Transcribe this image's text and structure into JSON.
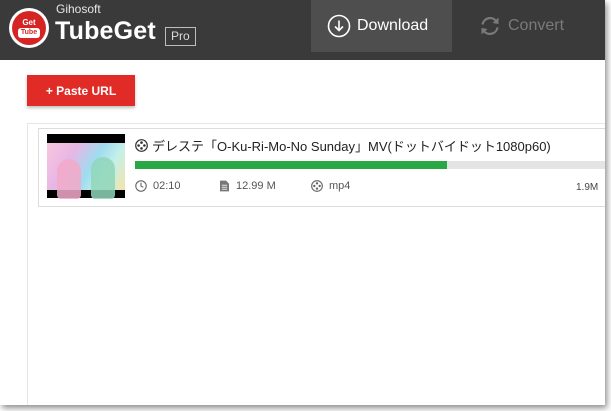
{
  "app": {
    "brand_small": "Gihosoft",
    "brand_name": "TubeGet",
    "edition_badge": "Pro",
    "logo_text_top": "Get",
    "logo_text_bottom": "Tube"
  },
  "tabs": [
    {
      "label": "Download",
      "icon": "download-circle-icon",
      "active": true
    },
    {
      "label": "Convert",
      "icon": "convert-refresh-icon",
      "active": false
    }
  ],
  "toolbar": {
    "paste_url_label": "+ Paste URL"
  },
  "downloads": [
    {
      "title": "デレステ「O-Ku-Ri-Mo-No Sunday」MV(ドットバイドット1080p60)",
      "duration": "02:10",
      "size": "12.99 M",
      "format": "mp4",
      "speed": "1.9M",
      "progress_percent": 65
    }
  ],
  "colors": {
    "header_bg": "#3a3a3a",
    "active_tab_bg": "#4e4e4e",
    "accent_red": "#e02b27",
    "progress_green": "#27a844",
    "progress_track": "#e4e4e4"
  }
}
